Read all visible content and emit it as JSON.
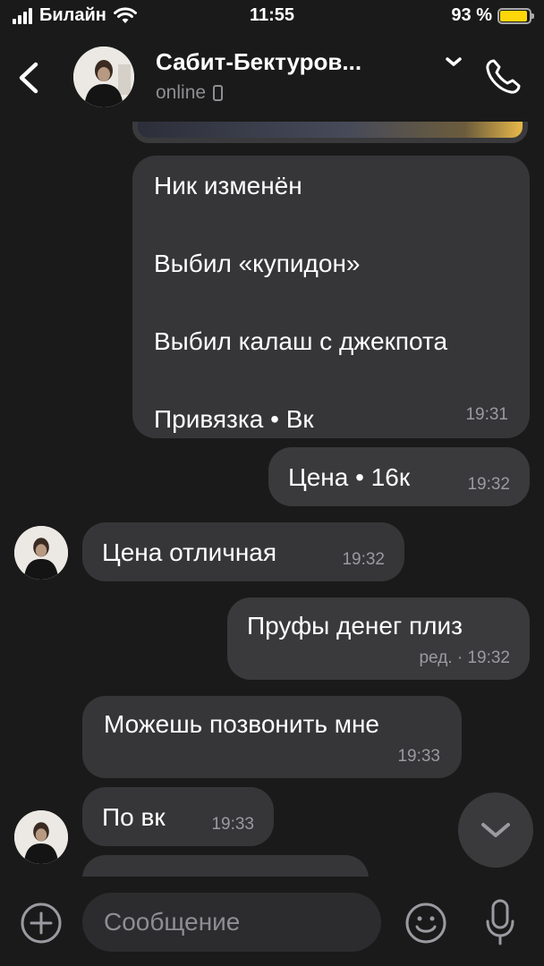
{
  "status_bar": {
    "carrier": "Билайн",
    "time": "11:55",
    "battery": "93 %",
    "battery_level": 0.93
  },
  "header": {
    "back_icon": "chevron-left-icon",
    "contact_name": "Сабит-Бектуров...",
    "status": "online",
    "menu_icon": "chevron-down-icon",
    "call_icon": "phone-icon"
  },
  "messages": [
    {
      "direction": "in",
      "lines": [
        "Ник изменён",
        "Выбил «купидон»",
        "Выбил калаш с джекпота",
        "Привязка • Вк"
      ],
      "time": "19:31"
    },
    {
      "direction": "out",
      "text": "Цена • 16к",
      "time": "19:32"
    },
    {
      "direction": "in",
      "text": "Цена отличная",
      "time": "19:32"
    },
    {
      "direction": "out",
      "text": "Пруфы денег плиз",
      "edited": "ред. ·",
      "time": "19:32"
    },
    {
      "direction": "in",
      "text": "Можешь позвонить мне",
      "time": "19:33"
    },
    {
      "direction": "in",
      "text": "По вк",
      "time": "19:33"
    }
  ],
  "composer": {
    "placeholder": "Сообщение",
    "attach_icon": "plus-circle-icon",
    "emoji_icon": "smile-icon",
    "mic_icon": "microphone-icon"
  },
  "colors": {
    "background": "#1a1a1a",
    "bubble": "#363638",
    "secondary_text": "#8e8e93",
    "battery": "#ffd60a"
  }
}
